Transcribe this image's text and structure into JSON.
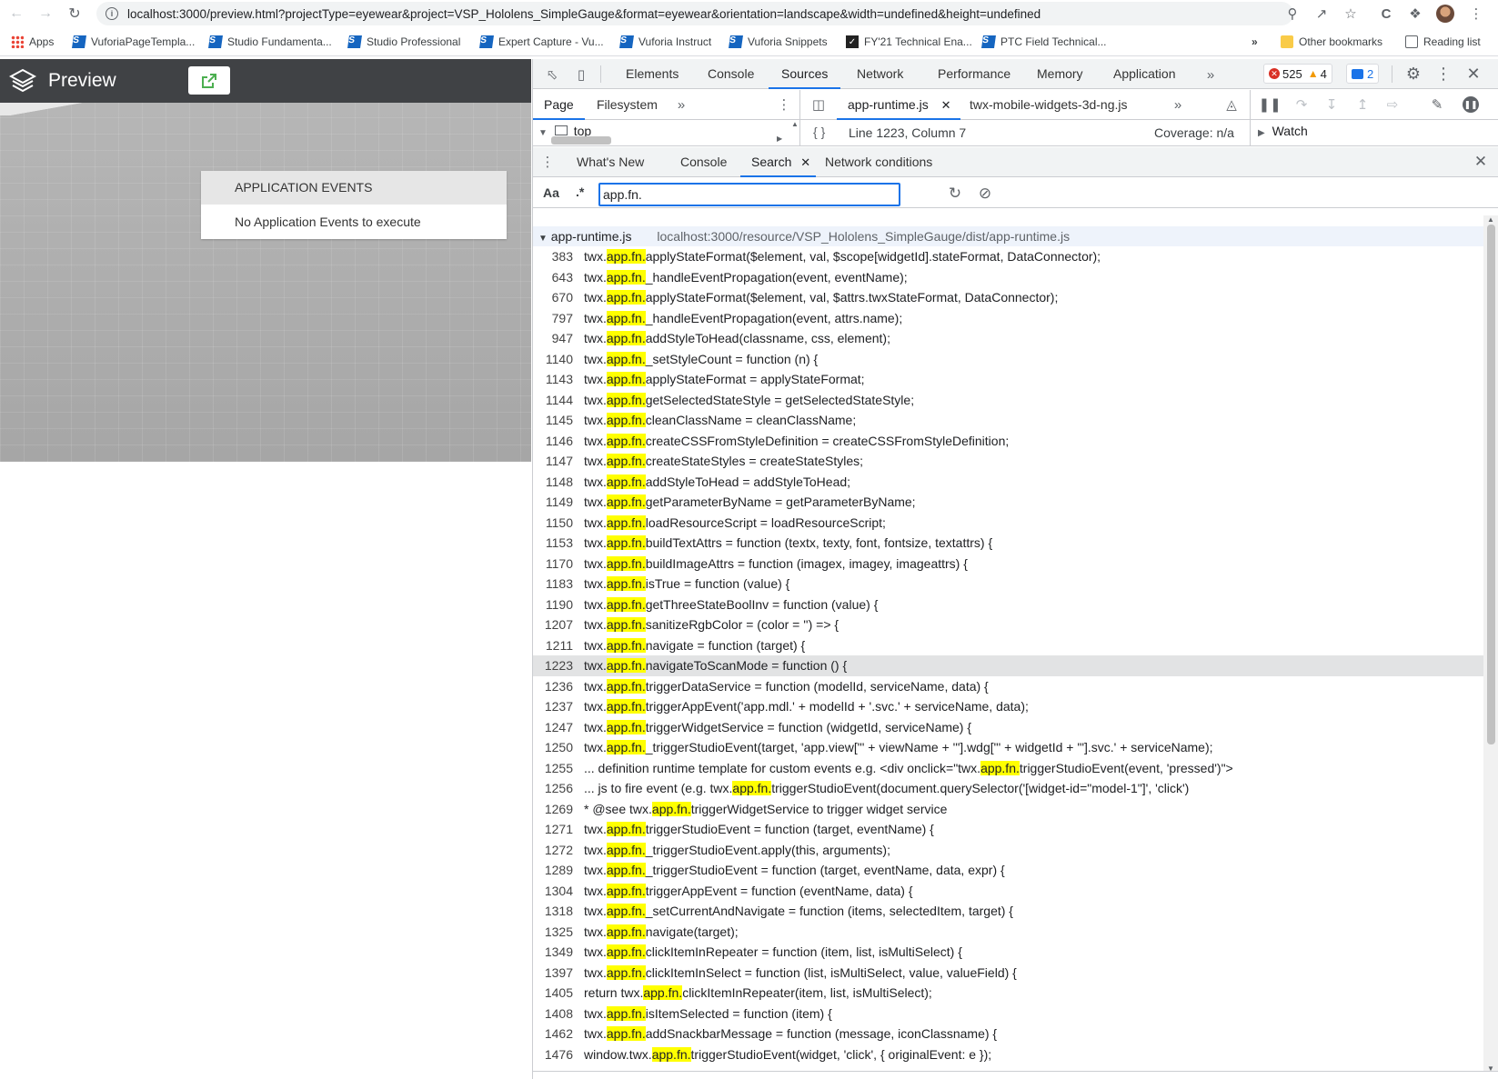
{
  "browser": {
    "url": "localhost:3000/preview.html?projectType=eyewear&project=VSP_Hololens_SimpleGauge&format=eyewear&orientation=landscape&width=undefined&height=undefined",
    "bookmarks": [
      {
        "label": "Apps",
        "icon": "apps-grid-icon"
      },
      {
        "label": "VuforiaPageTempla...",
        "icon": "studio-icon"
      },
      {
        "label": "Studio Fundamenta...",
        "icon": "studio-icon"
      },
      {
        "label": "Studio Professional",
        "icon": "studio-icon"
      },
      {
        "label": "Expert Capture - Vu...",
        "icon": "studio-icon"
      },
      {
        "label": "Vuforia Instruct",
        "icon": "studio-icon"
      },
      {
        "label": "Vuforia Snippets",
        "icon": "studio-icon"
      },
      {
        "label": "FY'21 Technical Ena...",
        "icon": "checkmark-icon"
      },
      {
        "label": "PTC Field Technical...",
        "icon": "studio-icon"
      }
    ],
    "more": "»",
    "other_bookmarks": "Other bookmarks",
    "reading_list": "Reading list"
  },
  "preview": {
    "title": "Preview",
    "events_header": "APPLICATION EVENTS",
    "events_body": "No Application Events to execute"
  },
  "devtools": {
    "tabs": [
      "Elements",
      "Console",
      "Sources",
      "Network",
      "Performance",
      "Memory",
      "Application"
    ],
    "selected_tab": "Sources",
    "error_count": "525",
    "warning_count": "4",
    "message_count": "2",
    "navigator_tabs": [
      "Page",
      "Filesystem"
    ],
    "frame": "top",
    "editor_tabs": [
      "app-runtime.js",
      "twx-mobile-widgets-3d-ng.js"
    ],
    "cursor_position": "Line 1223, Column 7",
    "coverage": "Coverage: n/a",
    "watch": "Watch",
    "drawer_tabs": [
      "What's New",
      "Console",
      "Search",
      "Network conditions"
    ],
    "search_case": "Aa",
    "search_regex": ".*",
    "search_query": "app.fn.",
    "result_file": "app-runtime.js",
    "result_path": "localhost:3000/resource/VSP_Hololens_SimpleGauge/dist/app-runtime.js",
    "selected_line": "1223",
    "results": [
      {
        "line": "383",
        "pre": "twx.",
        "post": "applyStateFormat($element, val, $scope[widgetId].stateFormat, DataConnector);"
      },
      {
        "line": "643",
        "pre": "twx.",
        "post": "_handleEventPropagation(event, eventName);"
      },
      {
        "line": "670",
        "pre": "twx.",
        "post": "applyStateFormat($element, val, $attrs.twxStateFormat, DataConnector);"
      },
      {
        "line": "797",
        "pre": "twx.",
        "post": "_handleEventPropagation(event, attrs.name);"
      },
      {
        "line": "947",
        "pre": "twx.",
        "post": "addStyleToHead(classname, css, element);"
      },
      {
        "line": "1140",
        "pre": "twx.",
        "post": "_setStyleCount = function (n) {"
      },
      {
        "line": "1143",
        "pre": "twx.",
        "post": "applyStateFormat = applyStateFormat;"
      },
      {
        "line": "1144",
        "pre": "twx.",
        "post": "getSelectedStateStyle = getSelectedStateStyle;"
      },
      {
        "line": "1145",
        "pre": "twx.",
        "post": "cleanClassName = cleanClassName;"
      },
      {
        "line": "1146",
        "pre": "twx.",
        "post": "createCSSFromStyleDefinition = createCSSFromStyleDefinition;"
      },
      {
        "line": "1147",
        "pre": "twx.",
        "post": "createStateStyles = createStateStyles;"
      },
      {
        "line": "1148",
        "pre": "twx.",
        "post": "addStyleToHead = addStyleToHead;"
      },
      {
        "line": "1149",
        "pre": "twx.",
        "post": "getParameterByName = getParameterByName;"
      },
      {
        "line": "1150",
        "pre": "twx.",
        "post": "loadResourceScript = loadResourceScript;"
      },
      {
        "line": "1153",
        "pre": "twx.",
        "post": "buildTextAttrs = function (textx, texty, font, fontsize, textattrs) {"
      },
      {
        "line": "1170",
        "pre": "twx.",
        "post": "buildImageAttrs = function (imagex, imagey, imageattrs) {"
      },
      {
        "line": "1183",
        "pre": "twx.",
        "post": "isTrue = function (value) {"
      },
      {
        "line": "1190",
        "pre": "twx.",
        "post": "getThreeStateBoolInv = function (value) {"
      },
      {
        "line": "1207",
        "pre": "twx.",
        "post": "sanitizeRgbColor = (color = '') => {"
      },
      {
        "line": "1211",
        "pre": "twx.",
        "post": "navigate = function (target) {"
      },
      {
        "line": "1223",
        "pre": "twx.",
        "post": "navigateToScanMode = function () {"
      },
      {
        "line": "1236",
        "pre": "twx.",
        "post": "triggerDataService = function (modelId, serviceName, data) {"
      },
      {
        "line": "1237",
        "pre": "twx.",
        "post": "triggerAppEvent('app.mdl.' + modelId + '.svc.' + serviceName, data);"
      },
      {
        "line": "1247",
        "pre": "twx.",
        "post": "triggerWidgetService = function (widgetId, serviceName) {"
      },
      {
        "line": "1250",
        "pre": "twx.",
        "post": "_triggerStudioEvent(target, 'app.view[\"' + viewName + '\"].wdg[\"' + widgetId + '\"].svc.' + serviceName);"
      },
      {
        "line": "1255",
        "pre": "... definition runtime template for custom events e.g. <div onclick=\"twx.",
        "post": "triggerStudioEvent(event, 'pressed')\">"
      },
      {
        "line": "1256",
        "pre": "... js to fire event (e.g. twx.",
        "post": "triggerStudioEvent(document.querySelector('[widget-id=\"model-1\"]', 'click')"
      },
      {
        "line": "1269",
        "pre": "* @see twx.",
        "post": "triggerWidgetService to trigger widget service"
      },
      {
        "line": "1271",
        "pre": "twx.",
        "post": "triggerStudioEvent = function (target, eventName) {"
      },
      {
        "line": "1272",
        "pre": "twx.",
        "post": "_triggerStudioEvent.apply(this, arguments);"
      },
      {
        "line": "1289",
        "pre": "twx.",
        "post": "_triggerStudioEvent = function (target, eventName, data, expr) {"
      },
      {
        "line": "1304",
        "pre": "twx.",
        "post": "triggerAppEvent = function (eventName, data) {"
      },
      {
        "line": "1318",
        "pre": "twx.",
        "post": "_setCurrentAndNavigate = function (items, selectedItem, target) {"
      },
      {
        "line": "1325",
        "pre": "twx.",
        "post": "navigate(target);"
      },
      {
        "line": "1349",
        "pre": "twx.",
        "post": "clickItemInRepeater = function (item, list, isMultiSelect) {"
      },
      {
        "line": "1397",
        "pre": "twx.",
        "post": "clickItemInSelect = function (list, isMultiSelect, value, valueField) {"
      },
      {
        "line": "1405",
        "pre": "return twx.",
        "post": "clickItemInRepeater(item, list, isMultiSelect);"
      },
      {
        "line": "1408",
        "pre": "twx.",
        "post": "isItemSelected = function (item) {"
      },
      {
        "line": "1462",
        "pre": "twx.",
        "post": "addSnackbarMessage = function (message, iconClassname) {"
      },
      {
        "line": "1476",
        "pre": "window.twx.",
        "post": "triggerStudioEvent(widget, 'click', { originalEvent: e });"
      }
    ],
    "match_text": "app.fn.",
    "colors": {
      "highlight": "#ffff00",
      "accent": "#1a73e8",
      "error": "#d93025",
      "warning": "#f29900"
    }
  }
}
